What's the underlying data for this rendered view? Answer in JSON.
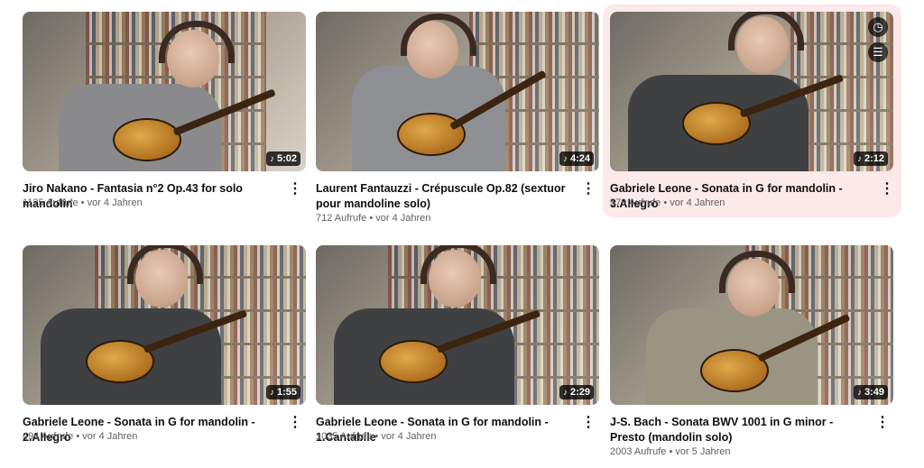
{
  "videos": [
    {
      "title": "Jiro Nakano - Fantasia n°2 Op.43 for solo mandolin",
      "views": "1125 Aufrufe",
      "age": "vor 4 Jahren",
      "duration": "5:02"
    },
    {
      "title": "Laurent Fantauzzi - Crépuscule Op.82 (sextuor pour mandoline solo)",
      "views": "712 Aufrufe",
      "age": "vor 4 Jahren",
      "duration": "4:24"
    },
    {
      "title": "Gabriele Leone - Sonata in G for mandolin - 3.Allegro",
      "views": "579 Aufrufe",
      "age": "vor 4 Jahren",
      "duration": "2:12"
    },
    {
      "title": "Gabriele Leone - Sonata in G for mandolin - 2.Allegro",
      "views": "494 Aufrufe",
      "age": "vor 4 Jahren",
      "duration": "1:55"
    },
    {
      "title": "Gabriele Leone - Sonata in G for mandolin - 1.Cantabile",
      "views": "1035 Aufrufe",
      "age": "vor 4 Jahren",
      "duration": "2:29"
    },
    {
      "title": "J-S. Bach - Sonata BWV 1001 in G minor - Presto (mandolin solo)",
      "views": "2003 Aufrufe",
      "age": "vor 5 Jahren",
      "duration": "3:49"
    }
  ],
  "separator": "•",
  "music_note": "♪",
  "more_icon": "⋮",
  "hover": {
    "watch_later_icon": "◷",
    "add_to_queue_icon": "☰"
  }
}
